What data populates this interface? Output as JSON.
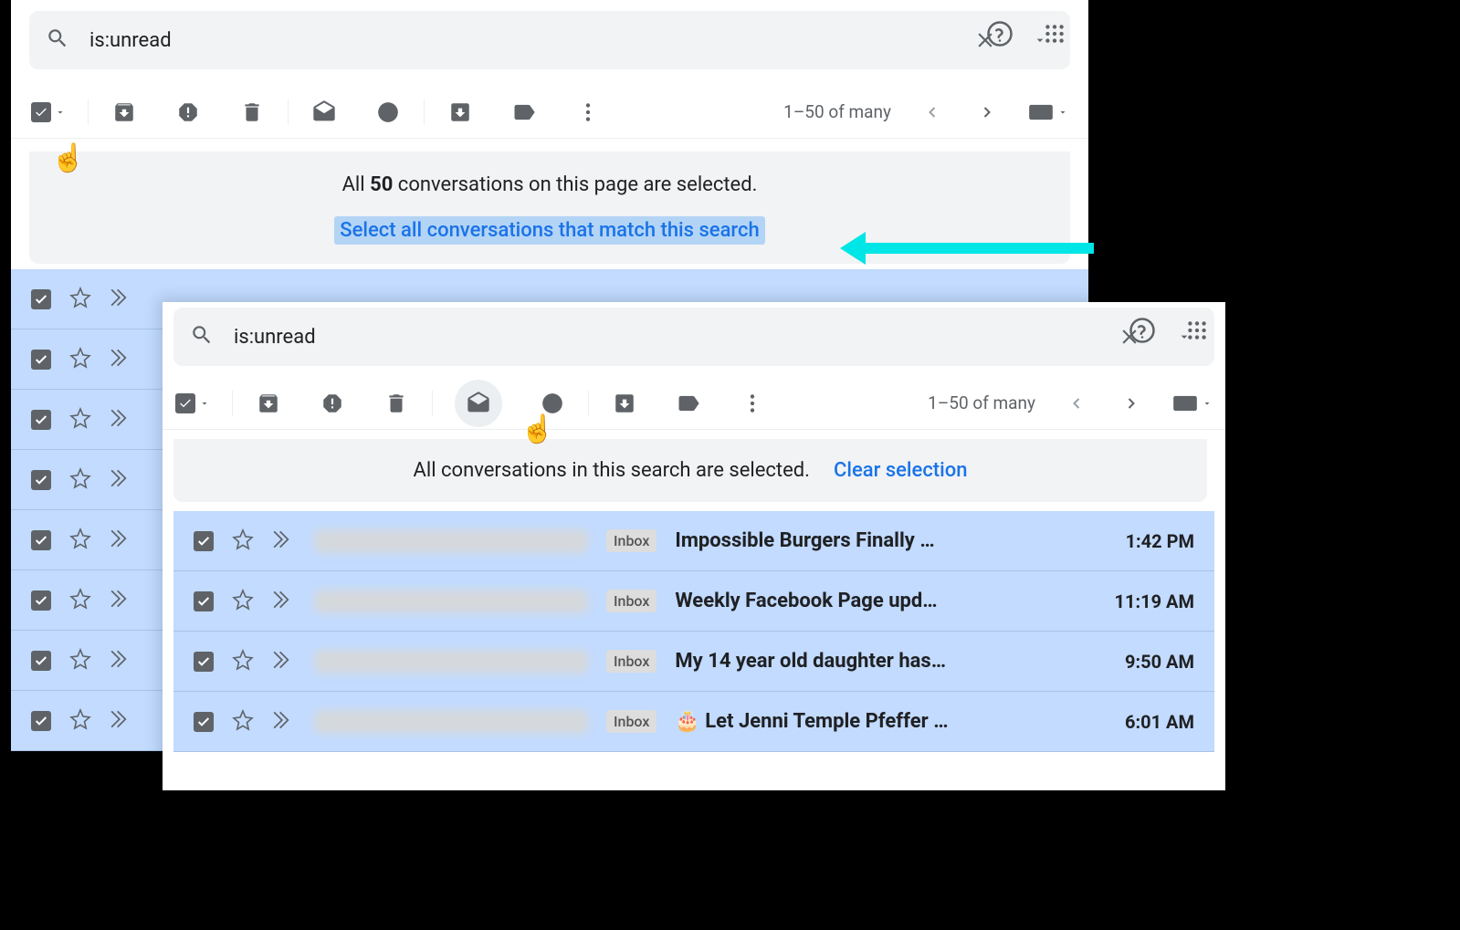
{
  "search": {
    "query": "is:unread"
  },
  "pagination": {
    "text": "1–50 of many"
  },
  "banner1": {
    "part1": "All ",
    "count": "50",
    "part2": " conversations on this page are selected.",
    "link": "Select all conversations that match this search"
  },
  "banner2": {
    "text": "All conversations in this search are selected.",
    "link": "Clear selection"
  },
  "messages": [
    {
      "label": "Inbox",
      "subject": "Impossible Burgers Finally …",
      "time": "1:42 PM"
    },
    {
      "label": "Inbox",
      "subject": "Weekly Facebook Page upd…",
      "time": "11:19 AM"
    },
    {
      "label": "Inbox",
      "subject": "My 14 year old daughter has…",
      "time": "9:50 AM"
    },
    {
      "label": "Inbox",
      "subject": "🎂 Let Jenni Temple Pfeffer …",
      "time": "6:01 AM"
    }
  ],
  "emptyrows": [
    0,
    1,
    2,
    3,
    4,
    5,
    6,
    7
  ]
}
